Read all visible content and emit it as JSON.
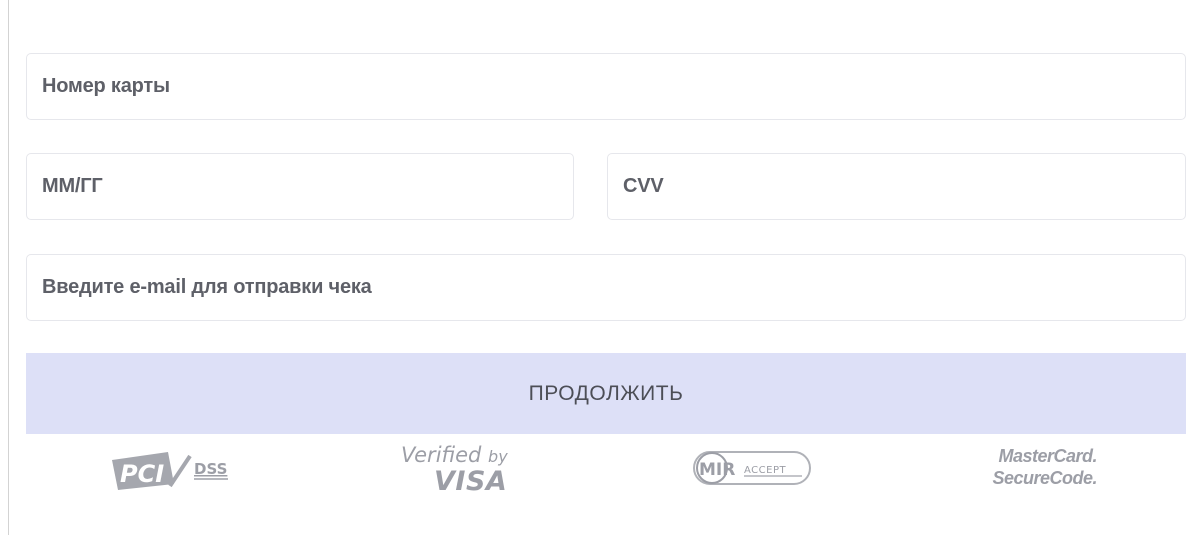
{
  "form": {
    "card_number_placeholder": "Номер карты",
    "expiry_placeholder": "ММ/ГГ",
    "cvv_placeholder": "CVV",
    "email_placeholder": "Введите e-mail для отправки чека",
    "continue_label": "ПРОДОЛЖИТЬ"
  },
  "logos": {
    "pci": {
      "text_main": "PCI",
      "text_sub": "DSS"
    },
    "visa": {
      "line1": "Verified",
      "by": "by",
      "line2": "VISA"
    },
    "mir": {
      "mir": "MIR",
      "accept": "ACCEPT"
    },
    "mastercard": {
      "line1": "MasterCard.",
      "line2": "SecureCode."
    }
  },
  "colors": {
    "button_bg": "#dde0f7",
    "field_border": "#e6e7ec",
    "placeholder_text": "#5e6068",
    "logo_gray": "#9c9ea6"
  }
}
